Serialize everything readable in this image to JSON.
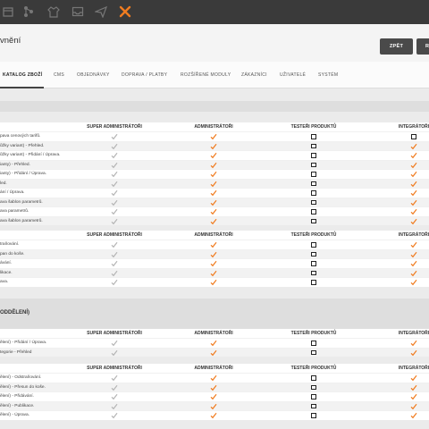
{
  "page": {
    "title": "vnění"
  },
  "toolbar": {
    "back_label": "ZPĚT",
    "more_label": "R"
  },
  "topbar": {
    "icons": [
      "box-icon",
      "tree-icon",
      "shirt-icon",
      "inbox-icon",
      "send-icon",
      "tools-icon"
    ],
    "accent_color": "#f07c20"
  },
  "tabs": [
    {
      "label": "KATALOG ZBOŽÍ",
      "active": true
    },
    {
      "label": "CMS"
    },
    {
      "label": "OBJEDNÁVKY"
    },
    {
      "label": "DOPRAVA / PLATBY"
    },
    {
      "label": "ROZŠÍŘENÉ MODULY"
    },
    {
      "label": "ZÁKAZNÍCI"
    },
    {
      "label": "UŽIVATELÉ"
    },
    {
      "label": "SYSTÉM"
    }
  ],
  "columns": [
    "SUPER ADMINISTRÁTOŘI",
    "ADMINISTRÁTOŘI",
    "TESTEŘI PRODUKTŮ",
    "INTEGRÁTOŘI"
  ],
  "section2": {
    "title": "ODDĚLENÍ)"
  },
  "table1": {
    "rows": [
      {
        "label": "pava cenových tarifů.",
        "values": [
          1,
          1,
          0,
          0
        ]
      },
      {
        "label": "ůžky variant) - Přehled.",
        "values": [
          1,
          1,
          0,
          1
        ]
      },
      {
        "label": "ůžky variant) - Přidání / Úprava.",
        "values": [
          1,
          1,
          0,
          1
        ]
      },
      {
        "label": "ianty) - Přehled.",
        "values": [
          1,
          1,
          0,
          1
        ]
      },
      {
        "label": "ianty) - Přidání / Úprava.",
        "values": [
          1,
          1,
          0,
          1
        ]
      },
      {
        "label": "led.",
        "values": [
          1,
          1,
          0,
          1
        ]
      },
      {
        "label": "ání / Úprava.",
        "values": [
          1,
          1,
          0,
          1
        ]
      },
      {
        "label": "ava šablon parametrů.",
        "values": [
          1,
          1,
          0,
          1
        ]
      },
      {
        "label": "ava parametrů.",
        "values": [
          1,
          1,
          0,
          1
        ]
      },
      {
        "label": "ava šablon parametrů.",
        "values": [
          1,
          1,
          0,
          1
        ]
      }
    ]
  },
  "table2": {
    "rows": [
      {
        "label": "traňování.",
        "values": [
          1,
          1,
          0,
          1
        ]
      },
      {
        "label": "pan do koše.",
        "values": [
          1,
          1,
          0,
          1
        ]
      },
      {
        "label": "ávání.",
        "values": [
          1,
          1,
          0,
          1
        ]
      },
      {
        "label": "likace.",
        "values": [
          1,
          1,
          0,
          1
        ]
      },
      {
        "label": "ava.",
        "values": [
          1,
          1,
          0,
          1
        ]
      }
    ]
  },
  "table3": {
    "rows": [
      {
        "label": "ělení) - Přidání / Úprava.",
        "values": [
          1,
          1,
          0,
          1
        ]
      },
      {
        "label": "tegorie - Přehled",
        "values": [
          1,
          1,
          0,
          1
        ]
      }
    ]
  },
  "table4": {
    "rows": [
      {
        "label": "ělení) - Odstraňování.",
        "values": [
          1,
          1,
          0,
          1
        ]
      },
      {
        "label": "ělení) - Přesun do koše.",
        "values": [
          1,
          1,
          0,
          1
        ]
      },
      {
        "label": "ělení) - Přidávání.",
        "values": [
          1,
          1,
          0,
          1
        ]
      },
      {
        "label": "ělení) - Publikace.",
        "values": [
          1,
          1,
          0,
          1
        ]
      },
      {
        "label": "ělení) - Úprava.",
        "values": [
          1,
          1,
          0,
          1
        ]
      }
    ]
  },
  "colors": {
    "check_super": "#b5b5b5",
    "check_active": "#f07c20",
    "topbar": "#3a3a3a"
  }
}
